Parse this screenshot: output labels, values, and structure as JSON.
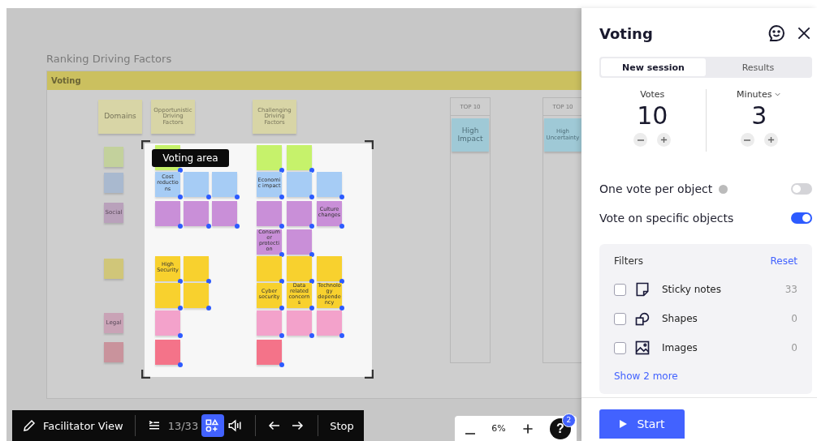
{
  "canvas": {
    "title": "Ranking Driving Factors",
    "frame": {
      "title": "Voting"
    },
    "headers": [
      {
        "text": "Domains",
        "color": "#d8d5a6"
      },
      {
        "text": "Opportunistic Driving Factors",
        "color": "#d8d5a6"
      },
      {
        "text": "Challenging Driving Factors",
        "color": "#d8d5a6"
      }
    ],
    "domains": [
      {
        "color": "#c3d19c"
      },
      {
        "color": "#a9b9cf"
      },
      {
        "text": "Social",
        "color": "#b9a1bb"
      },
      {
        "color": "#d0c679"
      },
      {
        "text": "Legal",
        "color": "#c9a3b6"
      },
      {
        "color": "#c9939c"
      }
    ],
    "voting_area": {
      "label": "Voting area"
    },
    "rows": [
      {
        "left": [
          {
            "color": "#c6f26b"
          }
        ],
        "right": [
          {
            "color": "#c6f26b"
          },
          {
            "color": "#c6f26b"
          }
        ]
      },
      {
        "left": [
          {
            "text": "Cost reductions",
            "color": "#a6ccf5"
          },
          {
            "color": "#a6ccf5"
          },
          {
            "color": "#a6ccf5"
          }
        ],
        "right": [
          {
            "text": "Economic impact",
            "color": "#a6ccf5"
          },
          {
            "color": "#a6ccf5"
          },
          {
            "color": "#a6ccf5"
          }
        ]
      },
      {
        "left": [
          {
            "color": "#c98fd8"
          },
          {
            "color": "#c98fd8"
          },
          {
            "color": "#c98fd8"
          }
        ],
        "right": [
          {
            "color": "#c98fd8"
          },
          {
            "color": "#c98fd8"
          },
          {
            "text": "Culture changes",
            "color": "#c98fd8"
          }
        ]
      },
      {
        "left": [],
        "right": [
          {
            "text": "Consumer protection",
            "color": "#c98fd8"
          },
          {
            "color": "#c98fd8"
          }
        ]
      },
      {
        "left": [
          {
            "text": "High Security",
            "color": "#f8d12e"
          },
          {
            "color": "#f8d12e"
          }
        ],
        "right": [
          {
            "color": "#f8d12e"
          },
          {
            "color": "#f8d12e"
          },
          {
            "color": "#f8d12e"
          }
        ]
      },
      {
        "left": [
          {
            "color": "#f8d12e"
          },
          {
            "color": "#f8d12e"
          }
        ],
        "right": [
          {
            "text": "Cyber security",
            "color": "#f8d12e"
          },
          {
            "text": "Data related concerns",
            "color": "#f8d12e"
          },
          {
            "text": "Technology dependency",
            "color": "#f8d12e"
          }
        ]
      },
      {
        "left": [
          {
            "color": "#f3a2cb"
          }
        ],
        "right": [
          {
            "color": "#f3a2cb"
          },
          {
            "color": "#f3a2cb"
          },
          {
            "color": "#f3a2cb"
          }
        ]
      },
      {
        "left": [
          {
            "color": "#f47389"
          }
        ],
        "right": [
          {
            "color": "#f47389"
          }
        ]
      }
    ],
    "top_columns": [
      {
        "title": "TOP 10",
        "note": "High Impact",
        "color": "#9fc9d6"
      },
      {
        "title": "TOP 10",
        "note": "High Uncertainty",
        "color": "#9fc9d6"
      }
    ]
  },
  "toolbar": [
    {
      "kind": "pencil",
      "label": "Facilitator View"
    },
    {
      "kind": "list",
      "label": "13/33"
    },
    {
      "kind": "shapes",
      "active": true
    },
    {
      "kind": "sound",
      "active": false
    },
    {
      "kind": "back"
    },
    {
      "kind": "forward"
    },
    {
      "kind": "text",
      "label": "Stop"
    }
  ],
  "zoom": {
    "value": "6%",
    "help": "?",
    "help_badge": "2"
  },
  "panel": {
    "title": "Voting",
    "tabs": [
      {
        "label": "New session",
        "selected": true
      },
      {
        "label": "Results",
        "selected": false
      }
    ],
    "counters": [
      {
        "label": "Votes",
        "value": "10",
        "dropdown": false
      },
      {
        "label": "Minutes",
        "value": "3",
        "dropdown": true
      }
    ],
    "toggles": [
      {
        "label": "One vote per object",
        "on": false,
        "help": true
      },
      {
        "label": "Vote on specific objects",
        "on": true,
        "help": false
      }
    ],
    "filters": {
      "title": "Filters",
      "reset": "Reset",
      "items": [
        {
          "kind": "sticky",
          "label": "Sticky notes",
          "count": "33",
          "checked": false
        },
        {
          "kind": "shapes",
          "label": "Shapes",
          "count": "0",
          "checked": false
        },
        {
          "kind": "image",
          "label": "Images",
          "count": "0",
          "checked": false
        }
      ],
      "more": "Show 2 more"
    },
    "start": "Start"
  }
}
